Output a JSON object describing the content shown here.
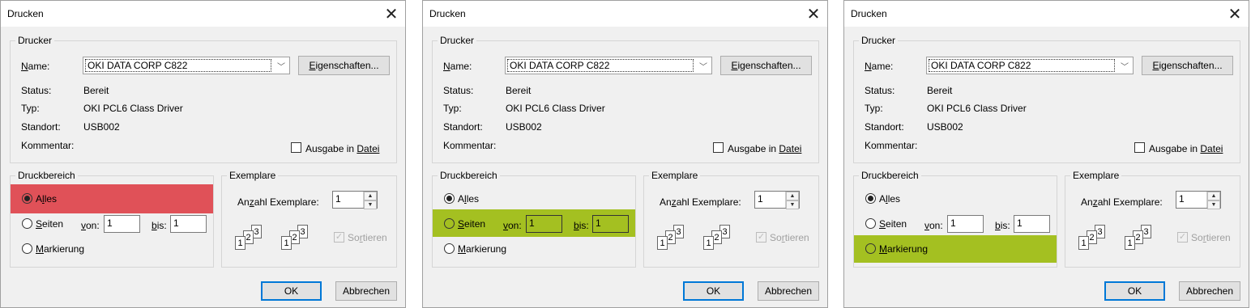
{
  "dialogs": [
    {
      "title": "Drucken",
      "printer": {
        "group_label": "Drucker",
        "name_label": "Name:",
        "name_value": "OKI DATA CORP C822",
        "properties_button": "Eigenschaften...",
        "status_label": "Status:",
        "status_value": "Bereit",
        "type_label": "Typ:",
        "type_value": "OKI PCL6 Class Driver",
        "location_label": "Standort:",
        "location_value": "USB002",
        "comment_label": "Kommentar:",
        "print_to_file": "Ausgabe in Datei"
      },
      "range": {
        "group_label": "Druckbereich",
        "all": "Alles",
        "pages": "Seiten",
        "from_label": "von:",
        "from_value": "1",
        "to_label": "bis:",
        "to_value": "1",
        "selection": "Markierung",
        "selected": "all",
        "highlight": "all",
        "highlight_color": "#e05158"
      },
      "copies": {
        "group_label": "Exemplare",
        "count_label": "Anzahl Exemplare:",
        "count_value": "1",
        "collate": "Sortieren"
      },
      "ok": "OK",
      "cancel": "Abbrechen"
    },
    {
      "title": "Drucken",
      "printer": {
        "group_label": "Drucker",
        "name_label": "Name:",
        "name_value": "OKI DATA CORP C822",
        "properties_button": "Eigenschaften...",
        "status_label": "Status:",
        "status_value": "Bereit",
        "type_label": "Typ:",
        "type_value": "OKI PCL6 Class Driver",
        "location_label": "Standort:",
        "location_value": "USB002",
        "comment_label": "Kommentar:",
        "print_to_file": "Ausgabe in Datei"
      },
      "range": {
        "group_label": "Druckbereich",
        "all": "Alles",
        "pages": "Seiten",
        "from_label": "von:",
        "from_value": "1",
        "to_label": "bis:",
        "to_value": "1",
        "selection": "Markierung",
        "selected": "all",
        "highlight": "pages",
        "highlight_color": "#a4c021"
      },
      "copies": {
        "group_label": "Exemplare",
        "count_label": "Anzahl Exemplare:",
        "count_value": "1",
        "collate": "Sortieren"
      },
      "ok": "OK",
      "cancel": "Abbrechen"
    },
    {
      "title": "Drucken",
      "printer": {
        "group_label": "Drucker",
        "name_label": "Name:",
        "name_value": "OKI DATA CORP C822",
        "properties_button": "Eigenschaften...",
        "status_label": "Status:",
        "status_value": "Bereit",
        "type_label": "Typ:",
        "type_value": "OKI PCL6 Class Driver",
        "location_label": "Standort:",
        "location_value": "USB002",
        "comment_label": "Kommentar:",
        "print_to_file": "Ausgabe in Datei"
      },
      "range": {
        "group_label": "Druckbereich",
        "all": "Alles",
        "pages": "Seiten",
        "from_label": "von:",
        "from_value": "1",
        "to_label": "bis:",
        "to_value": "1",
        "selection": "Markierung",
        "selected": "all",
        "highlight": "selection",
        "highlight_color": "#a4c021"
      },
      "copies": {
        "group_label": "Exemplare",
        "count_label": "Anzahl Exemplare:",
        "count_value": "1",
        "collate": "Sortieren"
      },
      "ok": "OK",
      "cancel": "Abbrechen"
    }
  ],
  "icons": {
    "close": "close-icon",
    "dropdown": "chevron-down-icon",
    "spin_up": "spin-up-icon",
    "spin_down": "spin-down-icon"
  }
}
